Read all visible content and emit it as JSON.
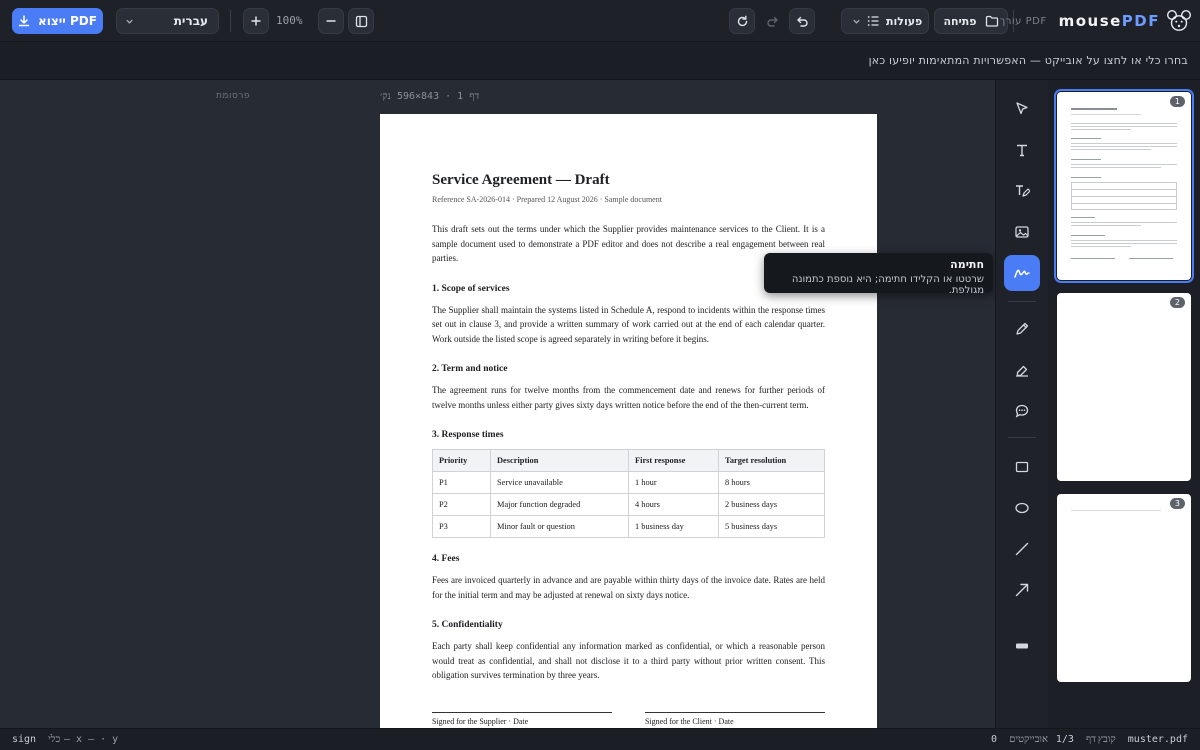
{
  "app": {
    "brand_prefix": "mouse",
    "brand_suffix": "PDF",
    "editor_label": "עורך PDF"
  },
  "toolbar": {
    "export_label": "ייצוא PDF",
    "language": "עברית",
    "zoom": "100%",
    "actions_label": "פעולות",
    "open_label": "פתיחה"
  },
  "hint": "בחרו כלי או לחצו על אובייקט — האפשרויות המתאימות יופיעו כאן",
  "canvas": {
    "ad_label": "פרסומת",
    "page_info": "דף 1 · 843×596 נק׳"
  },
  "tooltip": {
    "title": "חתימה",
    "description": "שרטטו או הקלידו חתימה; היא נוספת כתמונה מגולפת."
  },
  "document": {
    "title": "Service Agreement — Draft",
    "reference": "Reference SA-2026-014 · Prepared 12 August 2026 · Sample document",
    "intro": "This draft sets out the terms under which the Supplier provides maintenance services to the Client. It is a sample document used to demonstrate a PDF editor and does not describe a real engagement between real parties.",
    "sections": [
      {
        "heading": "1. Scope of services",
        "body": "The Supplier shall maintain the systems listed in Schedule A, respond to incidents within the response times set out in clause 3, and provide a written summary of work carried out at the end of each calendar quarter. Work outside the listed scope is agreed separately in writing before it begins."
      },
      {
        "heading": "2. Term and notice",
        "body": "The agreement runs for twelve months from the commencement date and renews for further periods of twelve months unless either party gives sixty days written notice before the end of the then-current term."
      },
      {
        "heading": "3. Response times",
        "body": ""
      },
      {
        "heading": "4. Fees",
        "body": "Fees are invoiced quarterly in advance and are payable within thirty days of the invoice date. Rates are held for the initial term and may be adjusted at renewal on sixty days notice."
      },
      {
        "heading": "5. Confidentiality",
        "body": "Each party shall keep confidential any information marked as confidential, or which a reasonable person would treat as confidential, and shall not disclose it to a third party without prior written consent. This obligation survives termination by three years."
      }
    ],
    "table": {
      "headers": [
        "Priority",
        "Description",
        "First response",
        "Target resolution"
      ],
      "rows": [
        [
          "P1",
          "Service unavailable",
          "1 hour",
          "8 hours"
        ],
        [
          "P2",
          "Major function degraded",
          "4 hours",
          "2 business days"
        ],
        [
          "P3",
          "Minor fault or question",
          "1 business day",
          "5 business days"
        ]
      ]
    },
    "sign_supplier": "Signed for the Supplier · Date",
    "sign_client": "Signed for the Client · Date"
  },
  "tools": [
    "select-icon",
    "text-icon",
    "edit-text-icon",
    "image-icon",
    "signature-icon",
    "pen-icon",
    "highlighter-icon",
    "comment-icon",
    "rectangle-icon",
    "ellipse-icon",
    "line-icon",
    "arrow-icon",
    "redact-icon"
  ],
  "active_tool": "signature-icon",
  "thumbnails": [
    {
      "number": "1"
    },
    {
      "number": "2"
    },
    {
      "number": "3"
    }
  ],
  "status": {
    "file_label": "קובץ",
    "file": "muster.pdf",
    "page_label": "דף",
    "page": "1/3",
    "objects_label": "אובייקטים",
    "objects": "0",
    "coords": "— x — · y",
    "tool_label": "כלי",
    "tool": "sign"
  },
  "colors": {
    "accent": "#4a7cf6",
    "bg": "#262a33"
  }
}
